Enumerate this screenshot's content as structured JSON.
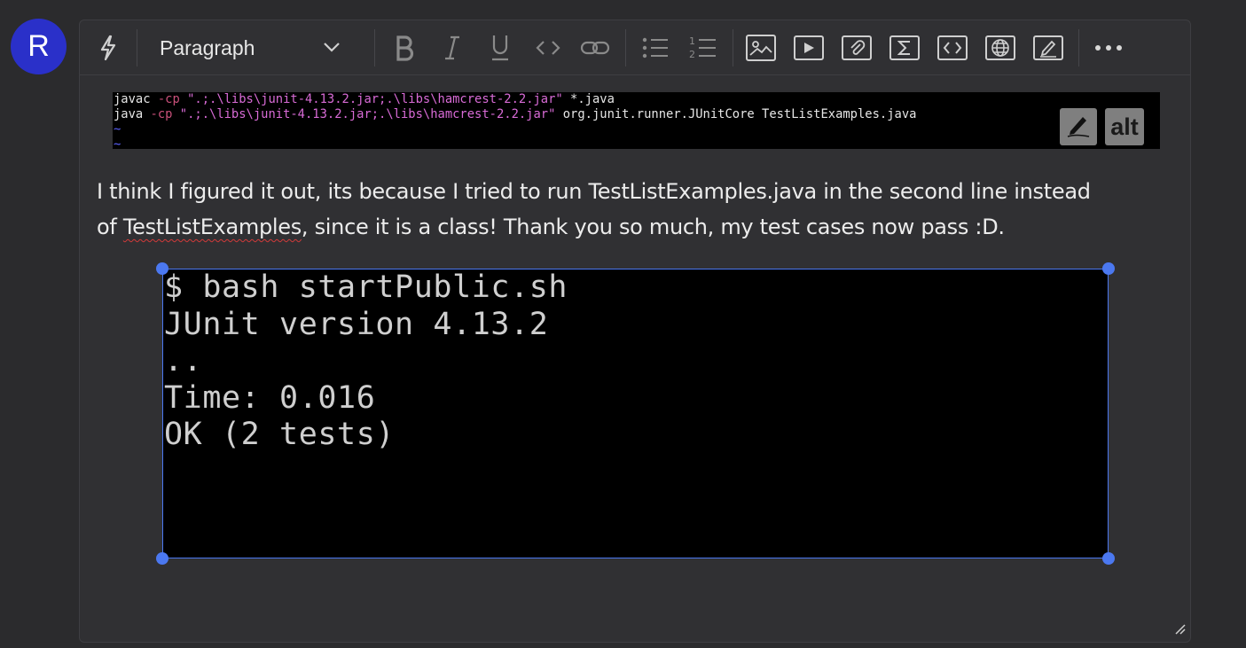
{
  "user": {
    "avatar_initial": "R"
  },
  "toolbar": {
    "block_format": "Paragraph",
    "tools": [
      "lightning-icon",
      "bold-icon",
      "italic-icon",
      "underline-icon",
      "code-icon",
      "link-icon",
      "bullet-list-icon",
      "numbered-list-icon",
      "image-icon",
      "video-icon",
      "attachment-icon",
      "equation-icon",
      "embed-code-icon",
      "web-embed-icon",
      "draw-icon",
      "more-icon"
    ]
  },
  "code_image": {
    "line1": {
      "cmd": "javac",
      "flag": "-cp",
      "arg": "\".;.\\libs\\junit-4.13.2.jar;.\\libs\\hamcrest-2.2.jar\"",
      "rest": "*.java"
    },
    "line2": {
      "cmd": "java",
      "flag": "-cp",
      "arg": "\".;.\\libs\\junit-4.13.2.jar;.\\libs\\hamcrest-2.2.jar\"",
      "rest": "org.junit.runner.JUnitCore TestListExamples.java"
    },
    "tilde": "~",
    "alt_label": "alt"
  },
  "message": {
    "line1": "I think I figured it out, its because I tried to run TestListExamples.java in the second line instead",
    "line2_prefix": "of ",
    "line2_misspelled": "TestListExamples",
    "line2_suffix": ", since it is a class! Thank you so much, my test cases now pass :D."
  },
  "terminal_image": {
    "lines": [
      "$ bash startPublic.sh",
      "JUnit version 4.13.2",
      "..",
      "Time: 0.016",
      "",
      "OK (2 tests)"
    ]
  },
  "colors": {
    "avatar": "#2a30c9",
    "selection": "#4b78f0",
    "background": "#2b2b2d"
  }
}
